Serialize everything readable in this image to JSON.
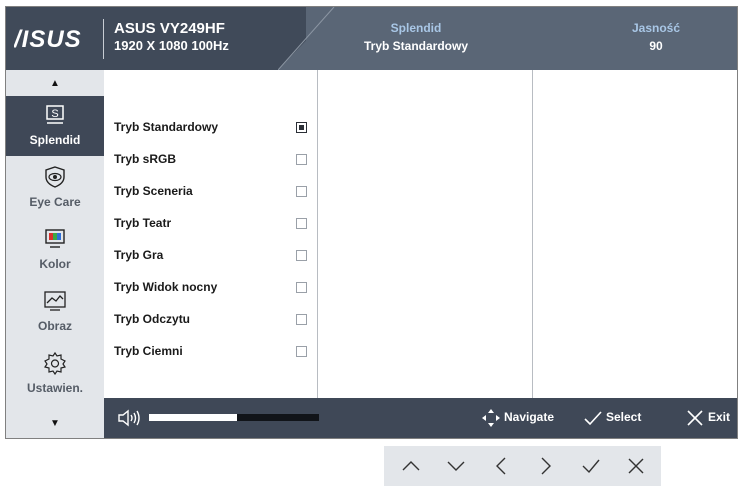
{
  "header": {
    "brand": "ASUS",
    "model": "ASUS VY249HF",
    "resolution": "1920 X 1080 100Hz",
    "splendid": {
      "label": "Splendid",
      "value": "Tryb Standardowy"
    },
    "brightness": {
      "label": "Jasność",
      "value": "90"
    }
  },
  "sidebar": {
    "items": [
      {
        "label": "Splendid",
        "icon": "splendid-icon",
        "active": true
      },
      {
        "label": "Eye Care",
        "icon": "eye-care-icon",
        "active": false
      },
      {
        "label": "Kolor",
        "icon": "color-icon",
        "active": false
      },
      {
        "label": "Obraz",
        "icon": "image-icon",
        "active": false
      },
      {
        "label": "Ustawien.",
        "icon": "settings-icon",
        "active": false
      }
    ]
  },
  "modes": [
    {
      "label": "Tryb Standardowy",
      "selected": true
    },
    {
      "label": "Tryb sRGB",
      "selected": false
    },
    {
      "label": "Tryb Sceneria",
      "selected": false
    },
    {
      "label": "Tryb Teatr",
      "selected": false
    },
    {
      "label": "Tryb Gra",
      "selected": false
    },
    {
      "label": "Tryb Widok nocny",
      "selected": false
    },
    {
      "label": "Tryb Odczytu",
      "selected": false
    },
    {
      "label": "Tryb Ciemni",
      "selected": false
    }
  ],
  "bottombar": {
    "volume_fraction": 0.52,
    "navigate": "Navigate",
    "select": "Select",
    "exit": "Exit"
  },
  "colors": {
    "header_dark": "#404a59",
    "header_light": "#5a6676",
    "accent_label": "#a9c7e6",
    "sidebar_bg": "#e3e6ea",
    "sidebar_active": "#3f4857"
  },
  "keys": [
    "up-icon",
    "down-icon",
    "left-icon",
    "right-icon",
    "check-icon",
    "close-icon"
  ]
}
